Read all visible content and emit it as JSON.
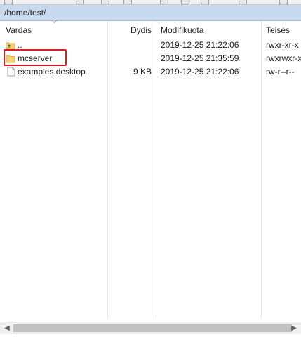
{
  "path_bar": {
    "path": "/home/test/"
  },
  "columns": {
    "name": "Vardas",
    "size": "Dydis",
    "modified": "Modifikuota",
    "perms": "Teisės"
  },
  "rows": [
    {
      "name": "..",
      "size": "",
      "modified": "2019-12-25 21:22:06",
      "perms": "rwxr-xr-x",
      "icon": "folder-up-icon"
    },
    {
      "name": "mcserver",
      "size": "",
      "modified": "2019-12-25 21:35:59",
      "perms": "rwxrwxr-x",
      "icon": "folder-icon"
    },
    {
      "name": "examples.desktop",
      "size": "9 KB",
      "modified": "2019-12-25 21:22:06",
      "perms": "rw-r--r--",
      "icon": "file-icon"
    }
  ],
  "colors": {
    "path_bar_bg": "#c9d9ee",
    "highlight": "#e01b22",
    "folder": "#f3d27a"
  }
}
